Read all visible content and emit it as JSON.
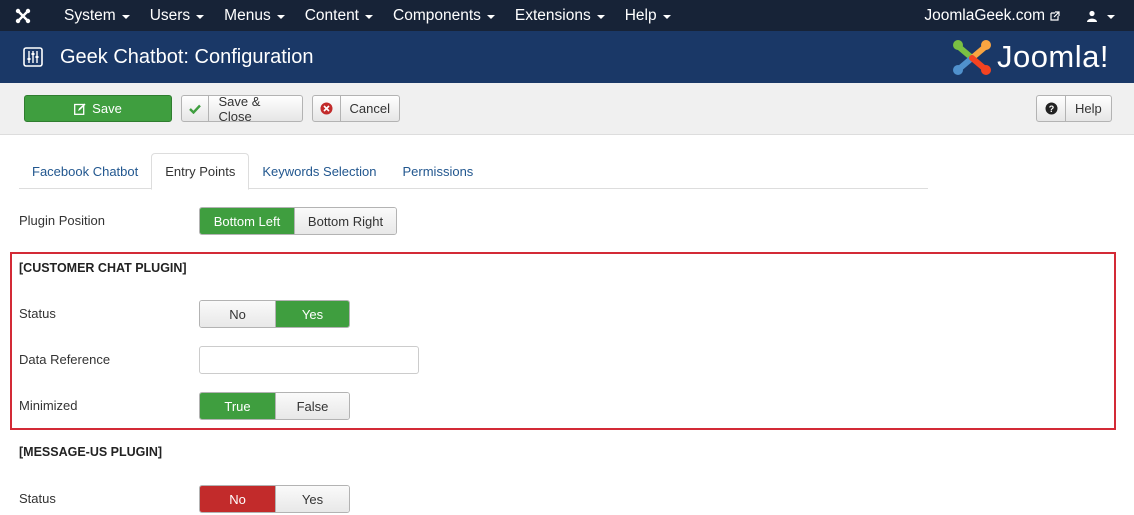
{
  "navbar": {
    "menu": [
      {
        "label": "System"
      },
      {
        "label": "Users"
      },
      {
        "label": "Menus"
      },
      {
        "label": "Content"
      },
      {
        "label": "Components"
      },
      {
        "label": "Extensions"
      },
      {
        "label": "Help"
      }
    ],
    "site_link": "JoomlaGeek.com"
  },
  "header": {
    "title": "Geek Chatbot: Configuration",
    "logo_text": "Joomla!"
  },
  "toolbar": {
    "save_label": "Save",
    "save_close_label": "Save & Close",
    "cancel_label": "Cancel",
    "help_label": "Help"
  },
  "tabs": [
    {
      "label": "Facebook Chatbot"
    },
    {
      "label": "Entry Points"
    },
    {
      "label": "Keywords Selection"
    },
    {
      "label": "Permissions"
    }
  ],
  "form": {
    "plugin_position": {
      "label": "Plugin Position",
      "options": [
        "Bottom Left",
        "Bottom Right"
      ],
      "selected": "Bottom Left"
    },
    "customer_chat": {
      "title": "[CUSTOMER CHAT PLUGIN]",
      "status": {
        "label": "Status",
        "options": [
          "No",
          "Yes"
        ],
        "selected": "Yes"
      },
      "data_reference": {
        "label": "Data Reference",
        "value": ""
      },
      "minimized": {
        "label": "Minimized",
        "options": [
          "True",
          "False"
        ],
        "selected": "True"
      }
    },
    "message_us": {
      "title": "[MESSAGE-US PLUGIN]",
      "status": {
        "label": "Status",
        "options": [
          "No",
          "Yes"
        ],
        "selected": "No"
      }
    }
  },
  "colors": {
    "navbar_bg": "#172337",
    "header_bg": "#1a3867",
    "success": "#3f9e3f",
    "danger": "#c22b2b",
    "link": "#22578f",
    "highlight": "#d32a36"
  }
}
